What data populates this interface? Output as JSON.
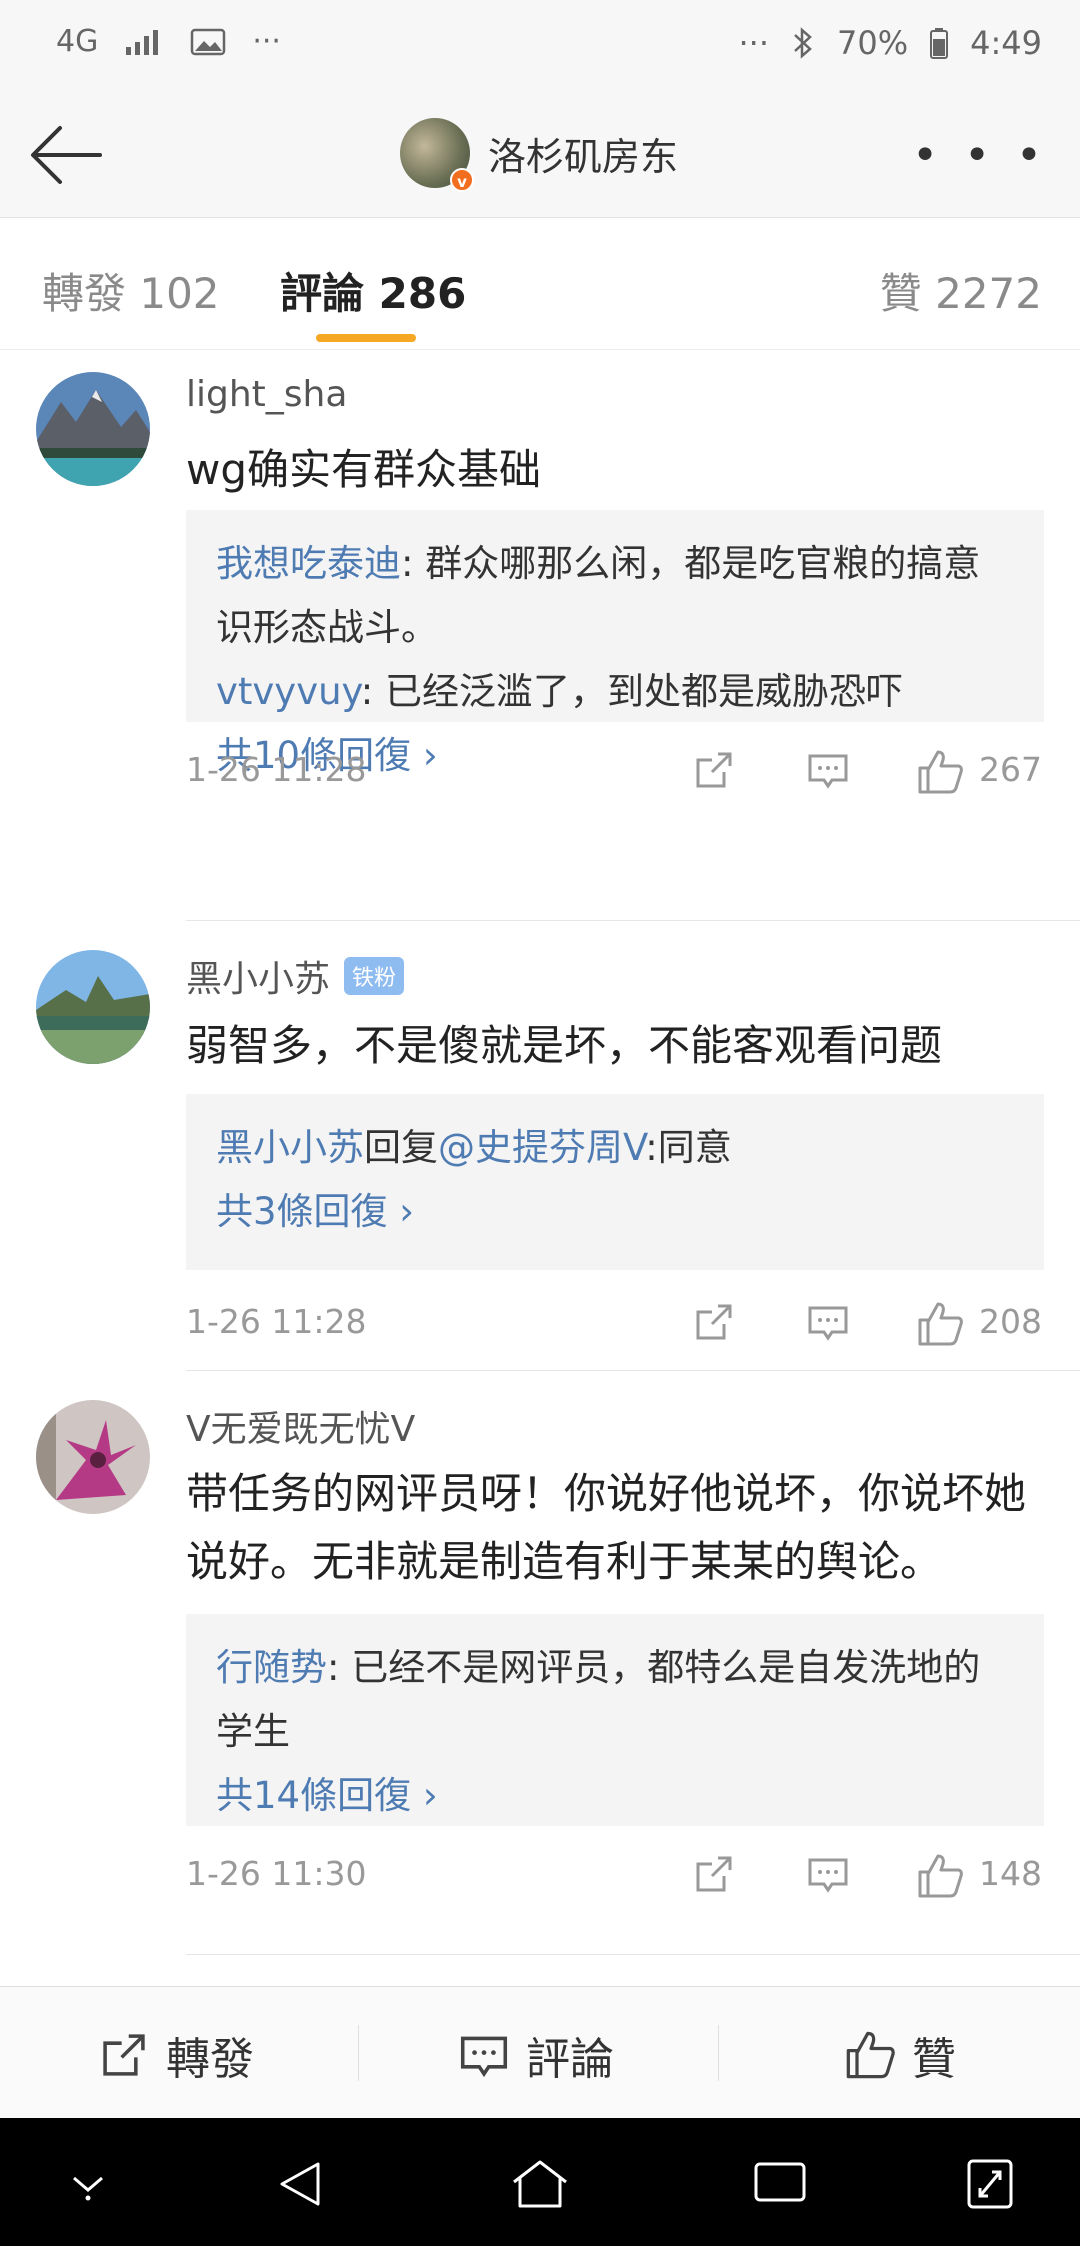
{
  "status_bar": {
    "network": "4G",
    "dots_left": "···",
    "dots_right": "···",
    "battery": "70%",
    "time": "4:49"
  },
  "nav": {
    "title": "洛杉矶房东",
    "verified_badge": "v",
    "back_icon": "back-arrow-icon",
    "more_icon": "more-dots-icon",
    "more_label": "• • •"
  },
  "tabs": [
    {
      "label": "轉發 102"
    },
    {
      "label": "評論 286"
    },
    {
      "label": "贊 2272"
    }
  ],
  "comments": [
    {
      "name": "light_sha",
      "text": "wg确实有群众基础",
      "replies": [
        {
          "author": "我想吃泰迪",
          "text": ": 群众哪那么闲，都是吃官粮的搞意识形态战斗。"
        },
        {
          "author": "vtvyvuy",
          "text": ": 已经泛滥了，到处都是威胁恐吓"
        }
      ],
      "more_replies": "共10條回復 ›",
      "time": "1-26 11:28",
      "likes": "267"
    },
    {
      "name": "黑小小苏",
      "badge": "铁粉",
      "text": "弱智多，不是傻就是坏，不能客观看问题",
      "reply_line": {
        "author": "黑小小苏",
        "mid": "回复",
        "mention": "@史提芬周V",
        "rest": ":同意"
      },
      "more_replies": "共3條回復 ›",
      "time": "1-26 11:28",
      "likes": "208"
    },
    {
      "name": "V无爱既无忧V",
      "text": "带任务的网评员呀！你说好他说坏，你说坏她说好。无非就是制造有利于某某的舆论。",
      "replies": [
        {
          "author": "行随势",
          "text": ": 已经不是网评员，都特么是自发洗地的学生"
        }
      ],
      "more_replies": "共14條回復 ›",
      "time": "1-26 11:30",
      "likes": "148"
    }
  ],
  "bottom_bar": {
    "repost": "轉發",
    "comment": "評論",
    "like": "贊"
  },
  "colors": {
    "accent": "#f6a723",
    "link": "#4f7bb3",
    "verified": "#f26d1e",
    "badge": "#8fbcf0"
  }
}
